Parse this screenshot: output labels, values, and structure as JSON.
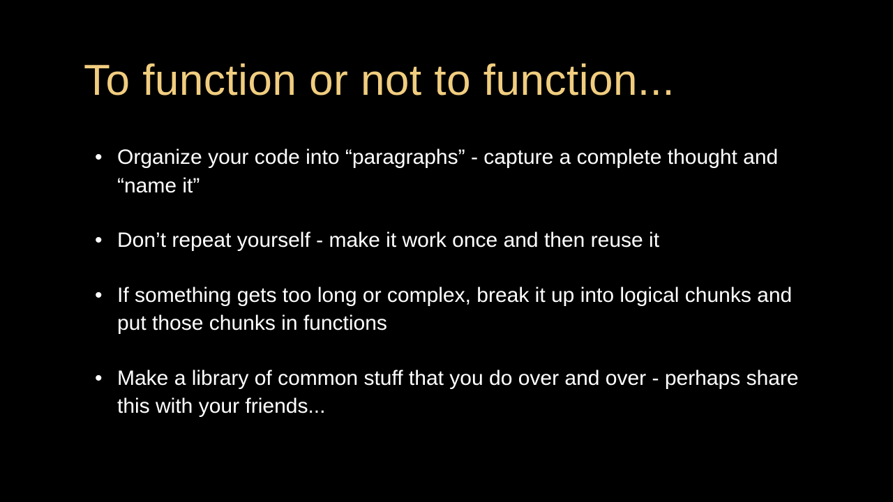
{
  "slide": {
    "title": "To function or not to function...",
    "bullets": [
      "Organize your code into “paragraphs” - capture a complete thought and “name it”",
      "Don’t repeat yourself - make it work once and then reuse it",
      "If something gets too long or complex, break it up into logical chunks and put those chunks in functions",
      "Make a library of common stuff that you do over and over - perhaps share this with your friends..."
    ]
  }
}
